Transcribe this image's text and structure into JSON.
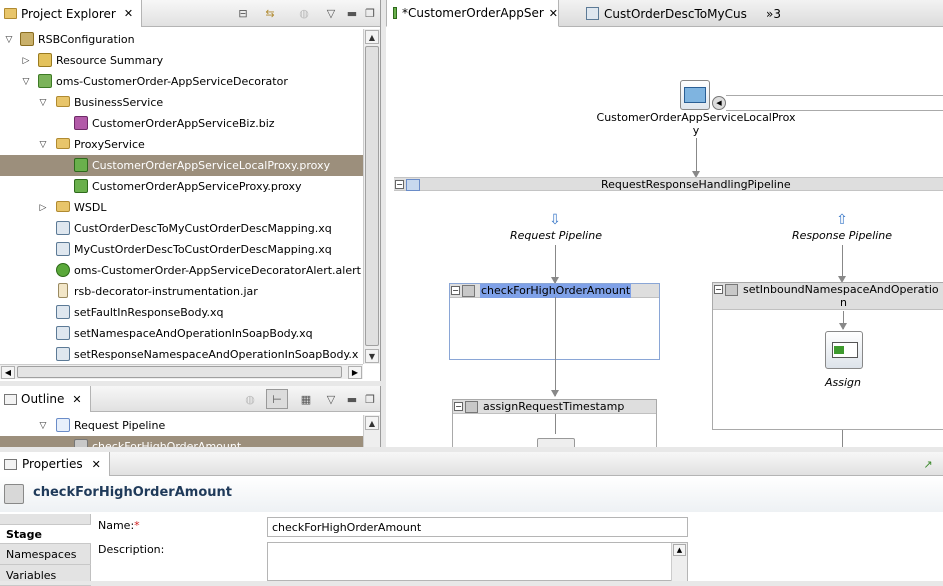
{
  "project_explorer": {
    "title": "Project Explorer",
    "items": [
      {
        "label": "RSBConfiguration"
      },
      {
        "label": "Resource Summary"
      },
      {
        "label": "oms-CustomerOrder-AppServiceDecorator"
      },
      {
        "label": "BusinessService"
      },
      {
        "label": "CustomerOrderAppServiceBiz.biz"
      },
      {
        "label": "ProxyService"
      },
      {
        "label": "CustomerOrderAppServiceLocalProxy.proxy"
      },
      {
        "label": "CustomerOrderAppServiceProxy.proxy"
      },
      {
        "label": "WSDL"
      },
      {
        "label": "CustOrderDescToMyCustOrderDescMapping.xq"
      },
      {
        "label": "MyCustOrderDescToCustOrderDescMapping.xq"
      },
      {
        "label": "oms-CustomerOrder-AppServiceDecoratorAlert.alert"
      },
      {
        "label": "rsb-decorator-instrumentation.jar"
      },
      {
        "label": "setFaultInResponseBody.xq"
      },
      {
        "label": "setNamespaceAndOperationInSoapBody.xq"
      },
      {
        "label": "setResponseNamespaceAndOperationInSoapBody.x"
      }
    ]
  },
  "outline": {
    "title": "Outline",
    "items": [
      {
        "label": "Request Pipeline"
      },
      {
        "label": "checkForHighOrderAmount"
      }
    ]
  },
  "editor": {
    "tabs": [
      {
        "label": "*CustomerOrderAppSer"
      },
      {
        "label": "CustOrderDescToMyCus"
      },
      {
        "label": "»3"
      }
    ],
    "proxy_label_line1": "CustomerOrderAppServiceLocalProx",
    "proxy_label_line2": "y",
    "pipeline_title": "RequestResponseHandlingPipeline",
    "request_pipeline": "Request Pipeline",
    "response_pipeline": "Response Pipeline",
    "stage1": "checkForHighOrderAmount",
    "stage2": "assignRequestTimestamp",
    "stage3_line1": "setInboundNamespaceAndOperatio",
    "stage3_line2": "n",
    "assign_label": "Assign"
  },
  "properties": {
    "title": "Properties",
    "header": "checkForHighOrderAmount",
    "side_tabs": [
      {
        "label": "Stage"
      },
      {
        "label": "Namespaces"
      },
      {
        "label": "Variables"
      }
    ],
    "name_label": "Name:",
    "required_mark": "*",
    "name_value": "checkForHighOrderAmount",
    "description_label": "Description:"
  },
  "colors": {
    "selection": "#9c8f7c",
    "highlight": "#7fa1e8",
    "title_blue": "#1f3a5a"
  }
}
